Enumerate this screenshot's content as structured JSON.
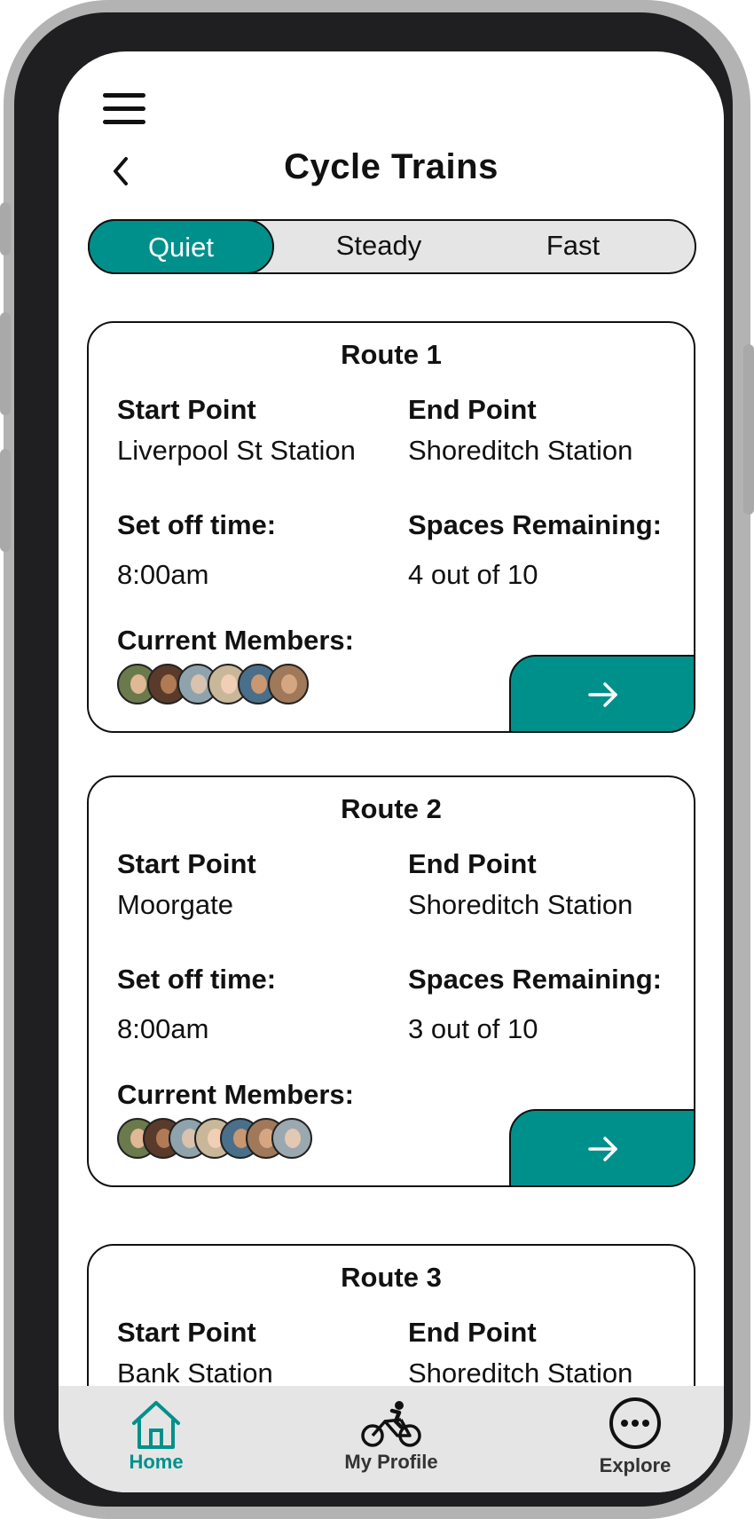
{
  "header": {
    "title": "Cycle Trains"
  },
  "filters": {
    "options": [
      "Quiet",
      "Steady",
      "Fast"
    ],
    "selected": "Quiet"
  },
  "routes": [
    {
      "title": "Route 1",
      "start_label": "Start Point",
      "start": "Liverpool St Station",
      "end_label": "End Point",
      "end": "Shoreditch Station",
      "time_label": "Set off time:",
      "time": "8:00am",
      "spaces_label": "Spaces Remaining:",
      "spaces": "4 out of 10",
      "members_label": "Current Members:",
      "member_count": 6
    },
    {
      "title": "Route 2",
      "start_label": "Start Point",
      "start": "Moorgate",
      "end_label": "End Point",
      "end": "Shoreditch Station",
      "time_label": "Set off time:",
      "time": "8:00am",
      "spaces_label": "Spaces Remaining:",
      "spaces": "3 out of 10",
      "members_label": "Current Members:",
      "member_count": 7
    },
    {
      "title": "Route 3",
      "start_label": "Start Point",
      "start": "Bank Station",
      "end_label": "End Point",
      "end": "Shoreditch Station"
    }
  ],
  "tabbar": {
    "items": [
      {
        "label": "Home",
        "icon": "home-icon",
        "active": true
      },
      {
        "label": "My Profile",
        "icon": "bicycle-icon",
        "active": false
      },
      {
        "label": "Explore",
        "icon": "more-icon",
        "active": false
      }
    ]
  },
  "colors": {
    "accent": "#00908c",
    "frame": "#1f1f21",
    "segment_bg": "#e5e5e5",
    "tabbar_bg": "#e5e5e5"
  }
}
